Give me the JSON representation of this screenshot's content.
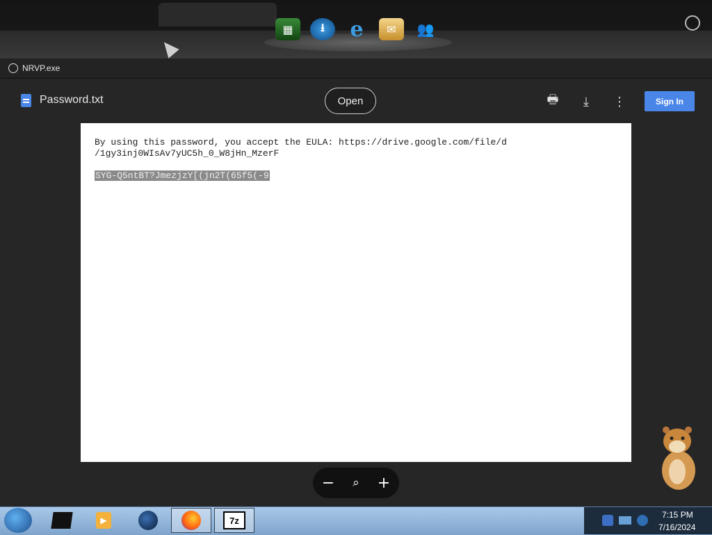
{
  "address_bar": {
    "text": "NRVP.exe"
  },
  "viewer": {
    "file_name": "Password.txt",
    "open_label": "Open",
    "sign_in_label": "Sign In",
    "accent_color": "#4a86e8"
  },
  "document": {
    "line1": "By using this password, you accept the EULA: https://drive.google.com/file/d",
    "line2": "/1gy3inj0WIsAv7yUC5h_0_W8jHn_MzerF",
    "password_highlighted": "SYG-Q5ntBT?JmezjzY[(jn2T(65f5(-9"
  },
  "zoom_controls": [
    "zoom-out-icon",
    "zoom-reset-icon",
    "zoom-in-icon"
  ],
  "dock_icons": [
    "grid-app-icon",
    "globe-download-icon",
    "internet-explorer-icon",
    "mail-icon",
    "messenger-icon"
  ],
  "taskbar": {
    "apps": [
      "start-orb",
      "black-box-app-icon",
      "media-player-icon",
      "globe-app-icon",
      "firefox-icon",
      "7zip-icon"
    ],
    "time": "7:15 PM",
    "date": "7/16/2024"
  }
}
